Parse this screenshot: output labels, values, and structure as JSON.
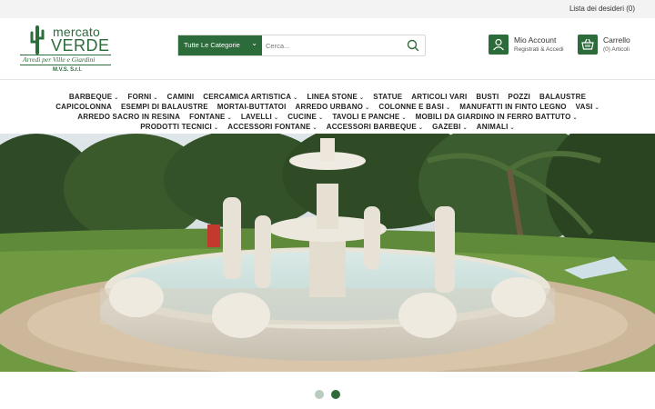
{
  "topbar": {
    "wishlist": "Lista dei desideri (0)"
  },
  "logo": {
    "line1": "mercato",
    "line2": "VERDE",
    "tagline": "Arredi per Ville e Giardini",
    "company": "M.V.S. S.r.l."
  },
  "search": {
    "category": "Tutte Le Categorie",
    "placeholder": "Cerca..."
  },
  "account": {
    "title": "Mio Account",
    "subtitle": "Registrati & Accedi"
  },
  "cart": {
    "title": "Carrello",
    "subtitle": "(0) Articoli"
  },
  "nav": {
    "row1": [
      {
        "label": "BARBEQUE",
        "dropdown": true
      },
      {
        "label": "FORNI",
        "dropdown": true
      },
      {
        "label": "CAMINI",
        "dropdown": false
      },
      {
        "label": "CERCAMICA ARTISTICA",
        "dropdown": true
      },
      {
        "label": "LINEA STONE",
        "dropdown": true
      },
      {
        "label": "STATUE",
        "dropdown": false
      },
      {
        "label": "ARTICOLI VARI",
        "dropdown": false
      },
      {
        "label": "BUSTI",
        "dropdown": false
      },
      {
        "label": "POZZI",
        "dropdown": false
      },
      {
        "label": "BALAUSTRE",
        "dropdown": false
      }
    ],
    "row2": [
      {
        "label": "CAPICOLONNA",
        "dropdown": false
      },
      {
        "label": "ESEMPI DI BALAUSTRE",
        "dropdown": false
      },
      {
        "label": "MORTAI-BUTTATOI",
        "dropdown": false
      },
      {
        "label": "ARREDO URBANO",
        "dropdown": true
      },
      {
        "label": "COLONNE E BASI",
        "dropdown": true
      },
      {
        "label": "MANUFATTI IN FINTO LEGNO",
        "dropdown": false
      },
      {
        "label": "VASI",
        "dropdown": true
      }
    ],
    "row3": [
      {
        "label": "ARREDO SACRO IN RESINA",
        "dropdown": false
      },
      {
        "label": "FONTANE",
        "dropdown": true
      },
      {
        "label": "LAVELLI",
        "dropdown": true
      },
      {
        "label": "CUCINE",
        "dropdown": true
      },
      {
        "label": "TAVOLI E PANCHE",
        "dropdown": true
      },
      {
        "label": "MOBILI DA GIARDINO IN FERRO BATTUTO",
        "dropdown": true
      }
    ],
    "row4": [
      {
        "label": "PRODOTTI TECNICI",
        "dropdown": true
      },
      {
        "label": "ACCESSORI FONTANE",
        "dropdown": true
      },
      {
        "label": "ACCESSORI BARBEQUE",
        "dropdown": true
      },
      {
        "label": "GAZEBI",
        "dropdown": true
      },
      {
        "label": "ANIMALI",
        "dropdown": true
      }
    ]
  },
  "slider": {
    "active_index": 1,
    "count": 2
  },
  "colors": {
    "brand": "#2c6b3a",
    "dot_inactive": "#b9ccc0",
    "dot_active": "#2c6b3a"
  }
}
